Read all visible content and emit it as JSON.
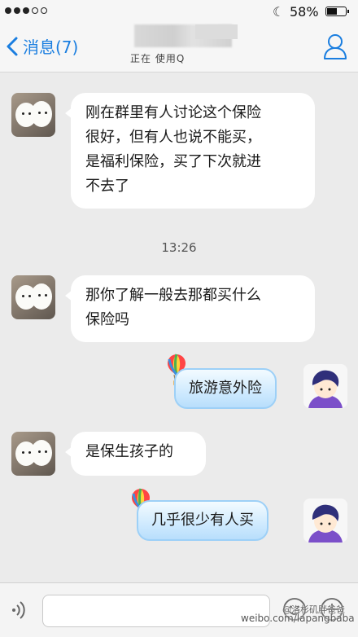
{
  "status_bar": {
    "battery_text": "58%",
    "battery_level": 0.58,
    "signal_dots_filled": 3,
    "signal_dots_total": 5,
    "icons": [
      "signal-dots",
      "moon-icon",
      "battery-icon"
    ]
  },
  "nav": {
    "back_label": "消息(7)",
    "subtitle": "正在        使用Q",
    "icons": [
      "chevron-left-icon",
      "person-icon"
    ],
    "accent_color": "#1a7ee0"
  },
  "messages": [
    {
      "side": "in",
      "text_lines": [
        "刚在群里有人讨论这个保险",
        "很好，但有人也说不能买，",
        "是福利保险，买了下次就进",
        "不去了"
      ]
    },
    {
      "side": "time",
      "text": "13:26"
    },
    {
      "side": "in",
      "text_lines": [
        "那你了解一般去那都买什么",
        "保险吗"
      ]
    },
    {
      "side": "out",
      "text": "旅游意外险"
    },
    {
      "side": "in",
      "text_lines": [
        "是保生孩子的"
      ]
    },
    {
      "side": "out",
      "text": "几乎很少有人买"
    }
  ],
  "input_bar": {
    "icons": [
      "voice-icon",
      "emoji-icon",
      "plus-icon"
    ]
  },
  "watermark": {
    "line1": "@洛杉矶胖爸爸",
    "line2": "weibo.com/lapangbaba"
  },
  "colors": {
    "background": "#ebebeb",
    "incoming_bubble": "#ffffff",
    "outgoing_bubble": "#cfeafe",
    "outgoing_border": "#9dd0f7"
  }
}
